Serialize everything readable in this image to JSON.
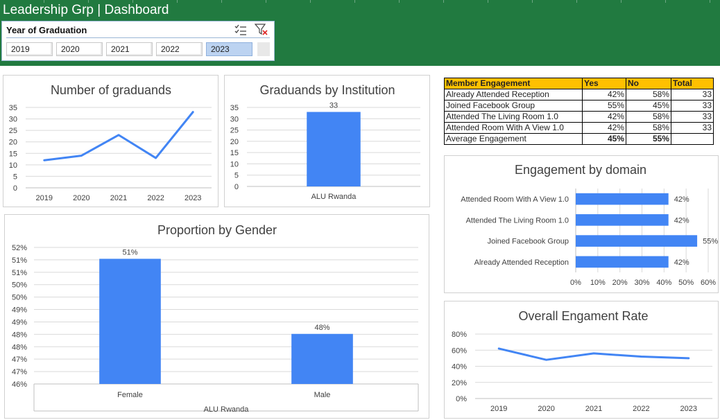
{
  "header": {
    "title": "Leadership Grp | Dashboard",
    "background": "#217a40"
  },
  "slicer": {
    "title": "Year of Graduation",
    "icons": [
      "multi-select-icon",
      "clear-filter-icon"
    ],
    "options": [
      "2019",
      "2020",
      "2021",
      "2022",
      "2023"
    ],
    "selected": "2023"
  },
  "engagement_table": {
    "headers": [
      "Member Engagement",
      "Yes",
      "No",
      "Total"
    ],
    "rows": [
      [
        "Already Attended Reception",
        "42%",
        "58%",
        "33"
      ],
      [
        "Joined Facebook Group",
        "55%",
        "45%",
        "33"
      ],
      [
        "Attended The Living Room 1.0",
        "42%",
        "58%",
        "33"
      ],
      [
        "Attended Room With A View 1.0",
        "42%",
        "58%",
        "33"
      ]
    ],
    "average": [
      "Average Engagement",
      "45%",
      "55%",
      ""
    ],
    "header_color": "#ffc000"
  },
  "chart_data": [
    {
      "id": "graduands",
      "type": "line",
      "title": "Number of graduands",
      "x": [
        "2019",
        "2020",
        "2021",
        "2022",
        "2023"
      ],
      "series": [
        {
          "values": [
            12,
            14,
            23,
            13,
            33
          ]
        }
      ],
      "ylim": [
        0,
        35
      ],
      "yticks": [
        "0",
        "5",
        "10",
        "15",
        "20",
        "25",
        "30",
        "35"
      ],
      "grid": true,
      "color": "#4285f4"
    },
    {
      "id": "institution",
      "type": "bar",
      "title": "Graduands by Institution",
      "categories": [
        "ALU Rwanda"
      ],
      "values": [
        33
      ],
      "labels": [
        "33"
      ],
      "ylim": [
        0,
        35
      ],
      "yticks": [
        "0",
        "5",
        "10",
        "15",
        "20",
        "25",
        "30",
        "35"
      ],
      "grid": true,
      "color": "#4285f4"
    },
    {
      "id": "gender",
      "type": "bar",
      "title": "Proportion by Gender",
      "categories": [
        "Female",
        "Male"
      ],
      "group_label": "ALU Rwanda",
      "values": [
        51.5,
        48.2
      ],
      "labels": [
        "51%",
        "48%"
      ],
      "ylim": [
        46,
        52
      ],
      "yticks": [
        "46%",
        "47%",
        "47%",
        "48%",
        "48%",
        "49%",
        "49%",
        "50%",
        "50%",
        "51%",
        "51%",
        "52%"
      ],
      "grid": true,
      "color": "#4285f4"
    },
    {
      "id": "domain",
      "type": "bar",
      "orientation": "horizontal",
      "title": "Engagement by domain",
      "categories": [
        "Attended Room With A View 1.0",
        "Attended The Living Room 1.0",
        "Joined Facebook Group",
        "Already Attended Reception"
      ],
      "values": [
        42,
        42,
        55,
        42
      ],
      "labels": [
        "42%",
        "42%",
        "55%",
        "42%"
      ],
      "xlim": [
        0,
        60
      ],
      "xticks": [
        "0%",
        "10%",
        "20%",
        "30%",
        "40%",
        "50%",
        "60%"
      ],
      "grid": true,
      "color": "#4285f4"
    },
    {
      "id": "overall",
      "type": "line",
      "title": "Overall Engament Rate",
      "x": [
        "2019",
        "2020",
        "2021",
        "2022",
        "2023"
      ],
      "series": [
        {
          "values": [
            62,
            48,
            56,
            52,
            50
          ]
        }
      ],
      "ylim": [
        0,
        80
      ],
      "yticks": [
        "0%",
        "20%",
        "40%",
        "60%",
        "80%"
      ],
      "grid": true,
      "color": "#4285f4"
    }
  ]
}
